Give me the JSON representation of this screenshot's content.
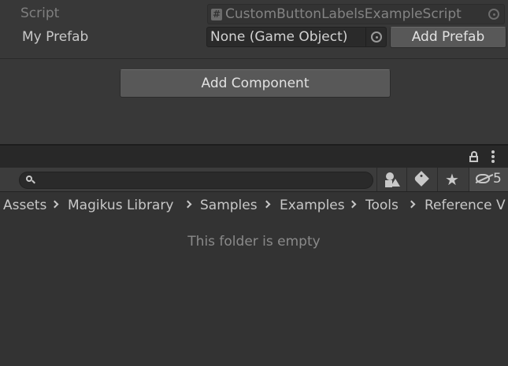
{
  "inspector": {
    "script_label": "Script",
    "script_value": "CustomButtonLabelsExampleScript",
    "prefab_label": "My Prefab",
    "prefab_value": "None (Game Object)",
    "add_prefab_button": "Add Prefab",
    "add_component_button": "Add Component"
  },
  "project": {
    "search_placeholder": "",
    "hidden_count": "5",
    "breadcrumbs": [
      "Assets",
      "Magikus Library",
      "Samples",
      "Examples",
      "Tools",
      "Reference V"
    ],
    "empty_message": "This folder is empty"
  },
  "icons": {
    "script_field": "hash-icon",
    "picker": "object-picker-icon",
    "lock": "lock-icon",
    "menu": "kebab-menu-icon",
    "search": "search-icon",
    "type_filter": "shapes-icon",
    "label_filter": "tag-icon",
    "favorites": "star-icon",
    "hidden_packages": "eye-slash-icon",
    "breadcrumb_separator": "chevron-right-icon"
  },
  "colors": {
    "panel_background": "#383838",
    "project_background": "#333333",
    "button": "#585858",
    "field": "#2a2a2a"
  }
}
